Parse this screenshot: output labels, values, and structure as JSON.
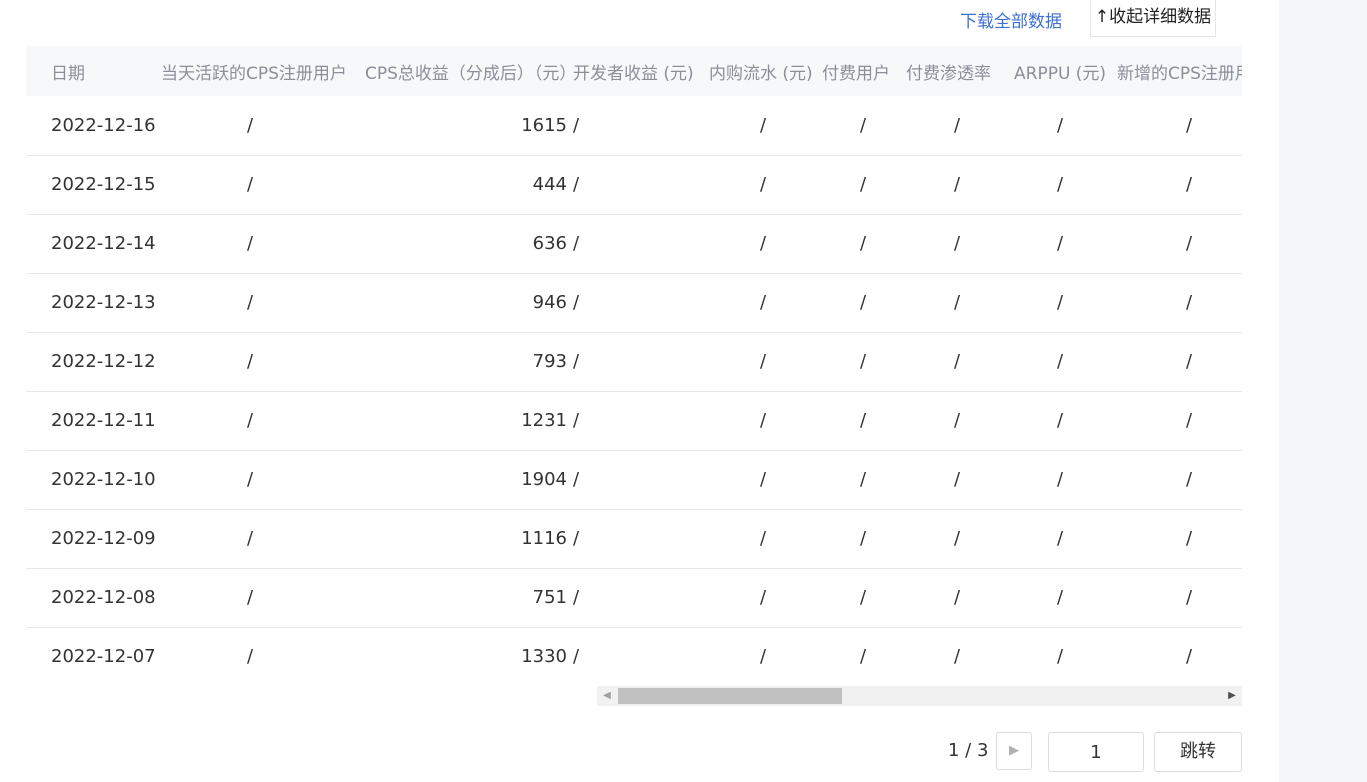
{
  "actions": {
    "download_all": "下载全部数据",
    "collapse_icon": "↑",
    "collapse_label": "收起详细数据"
  },
  "table": {
    "headers": [
      "日期",
      "当天活跃的CPS注册用户",
      "CPS总收益（分成后）（元）",
      "开发者收益 (元)",
      "内购流水 (元)",
      "付费用户",
      "付费渗透率",
      "ARPPU (元)",
      "新增的CPS注册用户"
    ],
    "rows": [
      [
        "2022-12-16",
        "/",
        "1615",
        "/",
        "/",
        "/",
        "/",
        "/",
        "/"
      ],
      [
        "2022-12-15",
        "/",
        "444",
        "/",
        "/",
        "/",
        "/",
        "/",
        "/"
      ],
      [
        "2022-12-14",
        "/",
        "636",
        "/",
        "/",
        "/",
        "/",
        "/",
        "/"
      ],
      [
        "2022-12-13",
        "/",
        "946",
        "/",
        "/",
        "/",
        "/",
        "/",
        "/"
      ],
      [
        "2022-12-12",
        "/",
        "793",
        "/",
        "/",
        "/",
        "/",
        "/",
        "/"
      ],
      [
        "2022-12-11",
        "/",
        "1231",
        "/",
        "/",
        "/",
        "/",
        "/",
        "/"
      ],
      [
        "2022-12-10",
        "/",
        "1904",
        "/",
        "/",
        "/",
        "/",
        "/",
        "/"
      ],
      [
        "2022-12-09",
        "/",
        "1116",
        "/",
        "/",
        "/",
        "/",
        "/",
        "/"
      ],
      [
        "2022-12-08",
        "/",
        "751",
        "/",
        "/",
        "/",
        "/",
        "/",
        "/"
      ],
      [
        "2022-12-07",
        "/",
        "1330",
        "/",
        "/",
        "/",
        "/",
        "/",
        "/"
      ]
    ]
  },
  "scrollbar": {
    "left_icon": "◀",
    "right_icon": "▶"
  },
  "pagination": {
    "page_text": "1 / 3",
    "next_icon": "▶",
    "page_input": "1",
    "jump_label": "跳转"
  }
}
